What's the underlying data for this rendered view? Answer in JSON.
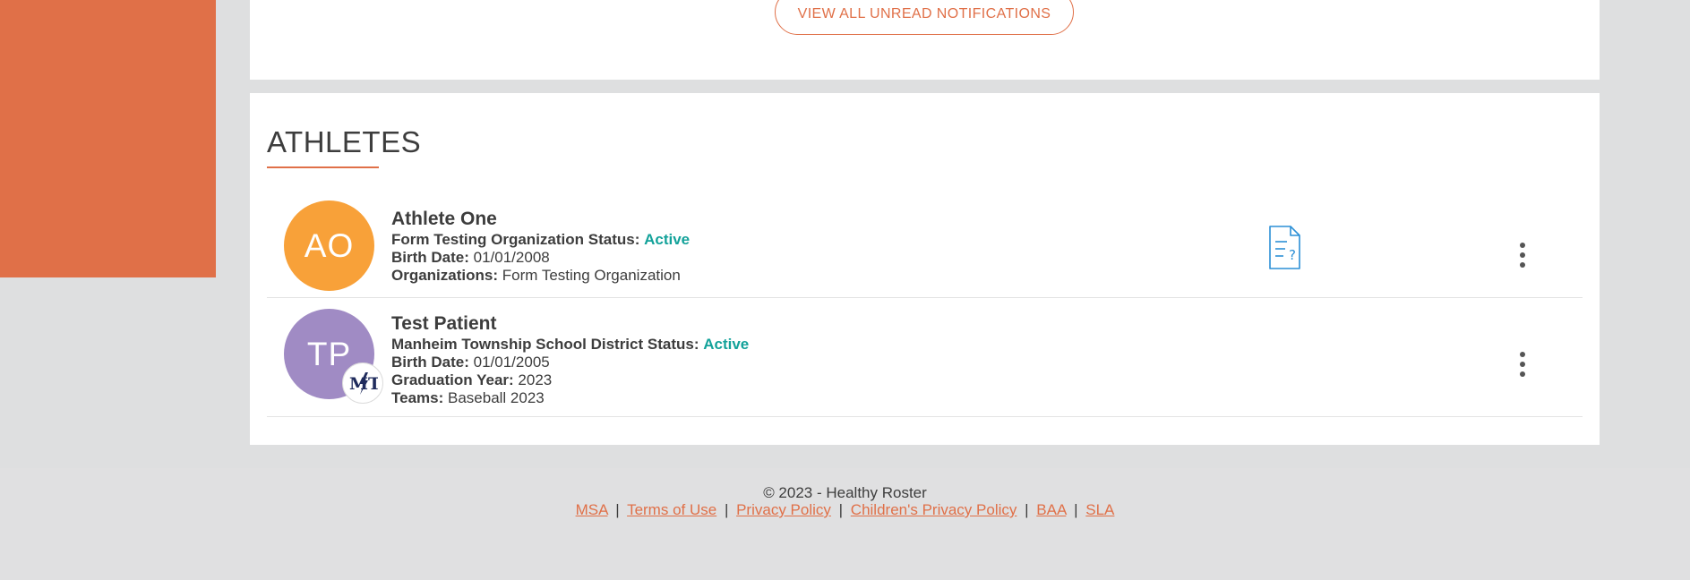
{
  "notifications": {
    "view_all_label": "VIEW ALL UNREAD NOTIFICATIONS"
  },
  "athletes": {
    "title": "ATHLETES",
    "items": [
      {
        "initials": "AO",
        "avatar_color": "#f8a139",
        "name": "Athlete One",
        "status_label": "Form Testing Organization Status:",
        "status_value": "Active",
        "birth_label": "Birth Date:",
        "birth_value": "01/01/2008",
        "org_label": "Organizations:",
        "org_value": "Form Testing Organization",
        "icons": [
          "form-question-document-icon",
          "more-options-icon"
        ]
      },
      {
        "initials": "TP",
        "avatar_color": "#a08bc4",
        "name": "Test Patient",
        "status_label": "Manheim Township School District Status:",
        "status_value": "Active",
        "birth_label": "Birth Date:",
        "birth_value": "01/01/2005",
        "grad_label": "Graduation Year:",
        "grad_value": "2023",
        "teams_label": "Teams:",
        "teams_value": "Baseball 2023",
        "org_logo_text": "MT",
        "icons": [
          "organization-logo-icon",
          "more-options-icon"
        ]
      }
    ]
  },
  "footer": {
    "copyright": "© 2023 - Healthy Roster",
    "links": {
      "msa": "MSA",
      "terms": "Terms of Use",
      "privacy": "Privacy Policy",
      "childrens_privacy": "Children's Privacy Policy",
      "baa": "BAA",
      "sla": "SLA"
    },
    "separator": "|"
  },
  "colors": {
    "brand_orange": "#e07048",
    "active_status": "#13a29a",
    "page_bg": "#dedfe0",
    "card_bg": "#ffffff",
    "icon_blue": "#2b8fd6"
  }
}
